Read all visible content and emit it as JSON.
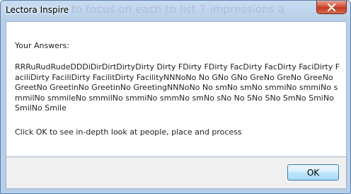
{
  "window": {
    "title": "Lectora Inspire",
    "background_text": "to focus on each to list 7 impressions a"
  },
  "content": {
    "label": "Your Answers:",
    "answers": "RRRuRudRudeDDDiDirDirtDirtyDirty Dirty FDirty FDirty FacDirty FacDirty FaciDirty FaciliDirty FaciliDirty FacilitDirty FacilityNNNoNo No GNo GNo GreNo GreNo GreeNo GreetNo GreetinNo GreetinNo GreetingNNNoNo No smNo smNo smmiNo smmiNo smmilNo smmileNo smmilNo smmiNo smmNo smNo sNo No SNo SNo SmNo SmiNo SmilNo Smile",
    "note": "Click OK to see in-depth look at people, place and process"
  },
  "footer": {
    "ok_label": "OK"
  },
  "icons": {
    "close": "close-icon"
  },
  "colors": {
    "close_button": "#c8432b",
    "ok_border": "#3c7fb1",
    "frame": "#b7cfe9"
  }
}
